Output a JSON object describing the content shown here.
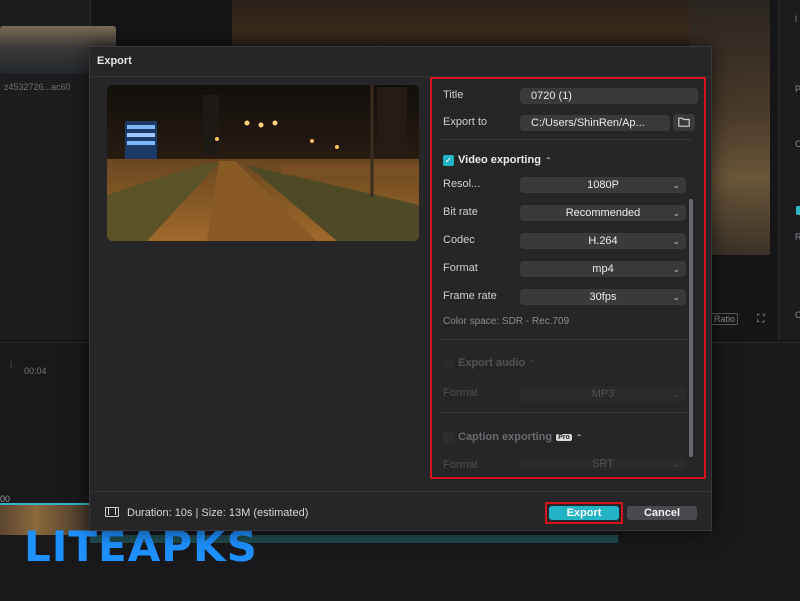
{
  "background": {
    "thumb_label": "z4532726...ac60",
    "timecode": "00:04",
    "ruler_marks": "|",
    "clip_label": "00",
    "ratio_label": "Ratio",
    "right_letters": [
      "l",
      "P",
      "C",
      "R",
      "C"
    ]
  },
  "watermark": {
    "text": "LITEAPKS",
    "color": "#1e90ff"
  },
  "dialog": {
    "title": "Export",
    "fields": {
      "title_label": "Title",
      "title_value": "0720 (1)",
      "export_to_label": "Export to",
      "export_to_value": "C:/Users/ShinRen/Ap...",
      "folder_icon": "folder-icon"
    },
    "video": {
      "section_label": "Video exporting",
      "checked": true,
      "rows": [
        {
          "label": "Resol...",
          "value": "1080P"
        },
        {
          "label": "Bit rate",
          "value": "Recommended"
        },
        {
          "label": "Codec",
          "value": "H.264"
        },
        {
          "label": "Format",
          "value": "mp4"
        },
        {
          "label": "Frame rate",
          "value": "30fps"
        }
      ],
      "color_space": "Color space: SDR - Rec.709"
    },
    "audio": {
      "section_label": "Export audio",
      "checked": false,
      "format_label": "Format",
      "format_value": "MP3"
    },
    "caption": {
      "section_label": "Caption exporting",
      "badge": "Pro",
      "checked": false,
      "format_label": "Format",
      "format_value": "SRT"
    },
    "footer": {
      "info": "Duration: 10s | Size: 13M (estimated)",
      "export_button": "Export",
      "cancel_button": "Cancel"
    }
  },
  "colors": {
    "accent": "#22b3c4",
    "highlight_border": "#d6141e",
    "dialog_bg": "#262628"
  }
}
